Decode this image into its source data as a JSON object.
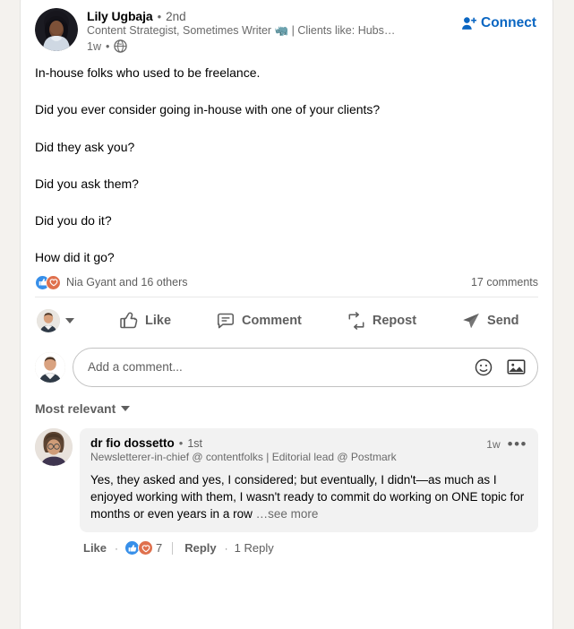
{
  "post": {
    "author": {
      "name": "Lily Ugbaja",
      "degree": "2nd",
      "separator": "•",
      "headline": "Content Strategist, Sometimes Writer 🦏 | Clients like: Hubs…",
      "time": "1w",
      "visibility_icon": "globe-icon"
    },
    "connect_label": "Connect",
    "body_lines": [
      "In-house folks who used to be freelance.",
      "Did you ever consider going in-house with one of your clients?",
      "Did they ask you?",
      "Did you ask them?",
      "Did you do it?",
      "How did it go?"
    ],
    "social": {
      "reactors_text": "Nia Gyant and 16 others",
      "comments_count": "17 comments"
    },
    "actions": {
      "like": "Like",
      "comment": "Comment",
      "repost": "Repost",
      "send": "Send"
    },
    "composer": {
      "placeholder": "Add a comment...",
      "value": ""
    }
  },
  "comments_section": {
    "sort_label": "Most relevant",
    "comments": [
      {
        "name": "dr fio dossetto",
        "degree": "1st",
        "separator": "•",
        "headline": "Newsletterer-in-chief @ contentfolks | Editorial lead @ Postmark",
        "time": "1w",
        "menu_glyph": "•••",
        "text": "Yes, they asked and yes, I considered; but eventually, I didn't—as much as I enjoyed working with them, I wasn't ready to commit do working on ONE topic for months or even years in a row",
        "see_more": "…see more",
        "like_label": "Like",
        "reaction_count": "7",
        "reply_label": "Reply",
        "replies_label": "1 Reply",
        "dot": "·"
      }
    ]
  },
  "colors": {
    "brand_blue": "#0a66c2",
    "like_blue": "#378fe9",
    "love_red": "#df704d",
    "page_bg": "#f4f2ee",
    "comment_bg": "#f2f2f2"
  }
}
